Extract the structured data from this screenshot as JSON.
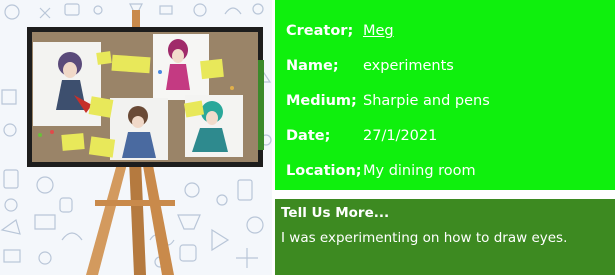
{
  "info": {
    "creator": {
      "label": "Creator;",
      "value": "Meg"
    },
    "name": {
      "label": "Name;",
      "value": "experiments"
    },
    "medium": {
      "label": "Medium;",
      "value": "Sharpie and pens"
    },
    "date": {
      "label": "Date;",
      "value": "27/1/2021"
    },
    "location": {
      "label": "Location;",
      "value": "My dining room"
    }
  },
  "more": {
    "title": "Tell Us More...",
    "body": "I was experimenting on how to draw eyes."
  },
  "colors": {
    "info_background": "#0ff00d",
    "more_background": "#3d8a21",
    "text": "#ffffff"
  },
  "artwork": {
    "subject": "photo of anime-style character drawings pinned to a corkboard with yellow sticky notes, displayed on a wooden easel",
    "background_pattern": "doodle-icons-pattern"
  }
}
